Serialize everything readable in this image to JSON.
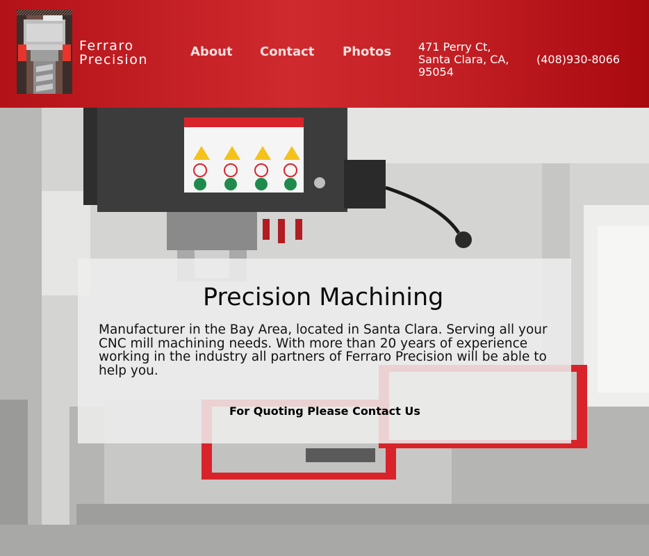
{
  "brand": {
    "line1": "Ferraro",
    "line2": "Precision"
  },
  "nav": {
    "items": [
      "About",
      "Contact",
      "Photos"
    ]
  },
  "address": {
    "line1": "471 Perry Ct,",
    "line2": "Santa Clara, CA,",
    "line3": "95054"
  },
  "phone": "(408)930-8066",
  "hero": {
    "title": "Precision Machining",
    "description": "Manufacturer in the Bay Area, located in Santa Clara. Serving all your CNC mill machining needs. With more than 20 years of experience working in the industry all partners of Ferraro Precision will be able to help you.",
    "cta": "For Quoting Please Contact Us"
  },
  "colors": {
    "header_red": "#c21f24",
    "accent_red": "#d81f2a",
    "white": "#ffffff"
  }
}
